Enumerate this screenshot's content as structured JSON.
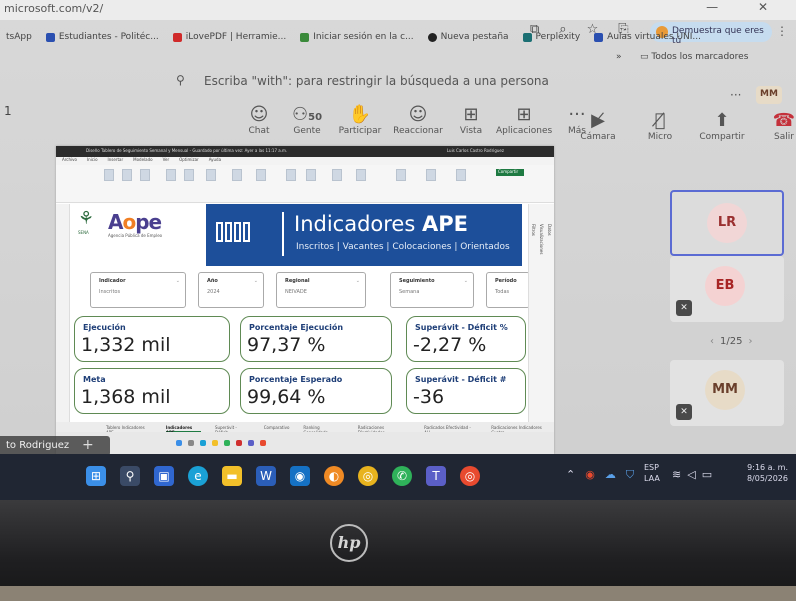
{
  "browser": {
    "url_fragment": "microsoft.com/v2/",
    "bookmarks": [
      {
        "label": "tsApp",
        "icon": "whatsapp-icon",
        "color": "#2e9d46"
      },
      {
        "label": "Estudiantes - Politéc...",
        "icon": "shield-icon",
        "color": "#2a4fb0"
      },
      {
        "label": "iLovePDF | Herramie...",
        "icon": "heart-icon",
        "color": "#d02a2a"
      },
      {
        "label": "Iniciar sesión en la c...",
        "icon": "leaf-icon",
        "color": "#3a8a3a"
      },
      {
        "label": "Nueva pestaña",
        "icon": "github-icon",
        "color": "#222222"
      },
      {
        "label": "Perplexity",
        "icon": "perplexity-icon",
        "color": "#1b6f73"
      },
      {
        "label": "Aulas virtuales UNI...",
        "icon": "shield-icon",
        "color": "#2a4fb0"
      }
    ],
    "profile_label": "Demuestra que eres tú",
    "bookmarks_folder": "Todos los marcadores"
  },
  "teams": {
    "search_placeholder": "Escriba \"with\": para restringir la búsqueda a una persona",
    "left_number": "1",
    "top_avatar": "MM",
    "toolbar": {
      "chat": "Chat",
      "people": "Gente",
      "people_count": "50",
      "raise": "Participar",
      "react": "Reaccionar",
      "view": "Vista",
      "apps": "Aplicaciones",
      "more": "Más",
      "camera": "Cámara",
      "mic": "Micro",
      "share": "Compartir",
      "leave": "Salir"
    },
    "participants": [
      {
        "initials": "LR",
        "bg": "#f1d6d6",
        "fg": "#9a3030"
      },
      {
        "initials": "EB",
        "bg": "#f4d2d2",
        "fg": "#a82525"
      },
      {
        "initials": "MM",
        "bg": "#e7dbc7",
        "fg": "#6a3f2b"
      }
    ],
    "pager": "1/25",
    "speaker_name": "to Rodriguez"
  },
  "pbi": {
    "window_title": "Diseño Tablero de Seguimiento Semanal y Mensual - Guardado por última vez: Ayer a las 11:17 a.m.",
    "user": "Luis Carlos Castro Rodriguez",
    "menu": [
      "Archivo",
      "Inicio",
      "Insertar",
      "Modelado",
      "Ver",
      "Optimizar",
      "Ayuda"
    ],
    "ribbon_button": "Compartir",
    "logo_text_main": "ᴿᴿ",
    "logo_word_a": "A",
    "logo_word_b": "pe",
    "logo_sub": "Agencia Pública de Empleo",
    "logo_left_sub": "SENA",
    "banner_title": "Indicadores",
    "banner_title_bold": "APE",
    "banner_sub": "Inscritos | Vacantes | Colocaciones | Orientados",
    "filters": [
      {
        "label": "Indicador",
        "value": "Inscritos"
      },
      {
        "label": "Año",
        "value": "2024"
      },
      {
        "label": "Regional",
        "value": "NEIVADE"
      },
      {
        "label": "Seguimiento",
        "value": "Semana"
      },
      {
        "label": "Período",
        "value": "Todas"
      }
    ],
    "kpis": [
      {
        "label": "Ejecución",
        "value": "1,332 mil"
      },
      {
        "label": "Porcentaje Ejecución",
        "value": "97,37 %"
      },
      {
        "label": "Superávit - Déficit %",
        "value": "-2,27 %"
      },
      {
        "label": "Meta",
        "value": "1,368 mil"
      },
      {
        "label": "Porcentaje Esperado",
        "value": "99,64 %"
      },
      {
        "label": "Superávit - Déficit #",
        "value": "-36"
      }
    ],
    "tabs": [
      "Tablero Indicadores APE",
      "Indicadores APE",
      "Superávit - Déficit",
      "Comparativo",
      "Ranking Consolidado",
      "Radicaciones Efectividades",
      "Radicados Efectividad - ALL",
      "Radicaciones Indicadores Cuatro"
    ],
    "active_tab_index": 1,
    "rail_labels": [
      "Filtros",
      "Visualizaciones",
      "Datos"
    ]
  },
  "taskbar": {
    "apps": [
      {
        "name": "windows-icon",
        "color": "#3b8fe8"
      },
      {
        "name": "search-icon",
        "color": "#5a6b85"
      },
      {
        "name": "files-icon",
        "color": "#3067d0"
      },
      {
        "name": "edge-icon",
        "color": "#1aa1d6"
      },
      {
        "name": "explorer-icon",
        "color": "#f2c02a"
      },
      {
        "name": "word-icon",
        "color": "#2b5eb8"
      },
      {
        "name": "outlook-icon",
        "color": "#1571c4"
      },
      {
        "name": "firefox-icon",
        "color": "#f08a24"
      },
      {
        "name": "chrome-icon",
        "color": "#e8b31e"
      },
      {
        "name": "whatsapp-icon",
        "color": "#2fb25a"
      },
      {
        "name": "teams-icon",
        "color": "#5b5fc7"
      },
      {
        "name": "chrome-alt-icon",
        "color": "#e84a2f"
      }
    ],
    "lang_top": "ESP",
    "lang_bottom": "LAA",
    "time": "9:16 a. m.",
    "date": "8/05/2026"
  },
  "laptop": {
    "brand": "hp"
  }
}
